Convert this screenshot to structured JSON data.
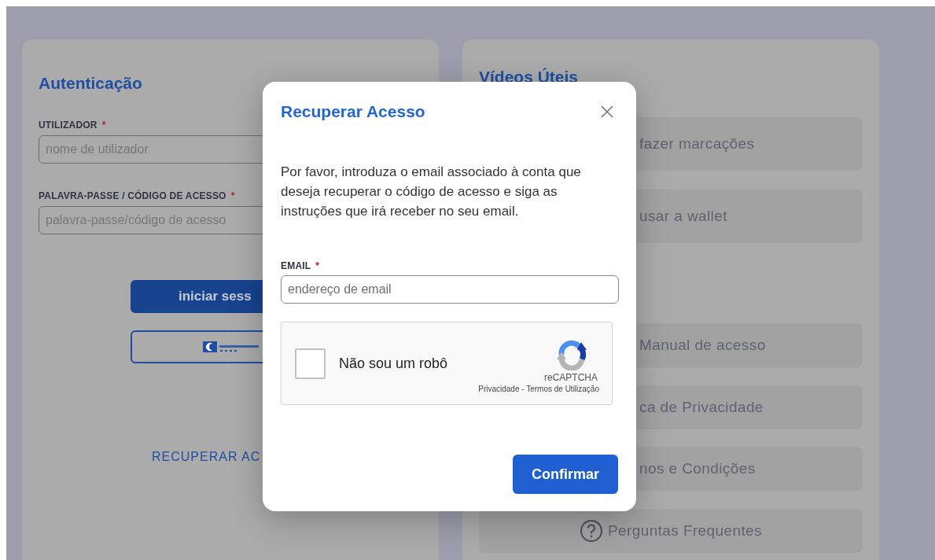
{
  "auth_panel": {
    "title": "Autenticação",
    "fields": [
      {
        "label": "UTILIZADOR",
        "required_mark": "*",
        "placeholder": "nome de utilizador"
      },
      {
        "label": "PALAVRA-PASSE / CÓDIGO DE ACESSO",
        "required_mark": "*",
        "placeholder": "palavra-passe/código de acesso"
      }
    ],
    "login_button": "iniciar sess",
    "recover_link": "RECUPERAR AC"
  },
  "videos_panel": {
    "title": "Vídeos Úteis",
    "items": [
      {
        "kind": "cut",
        "label": "fazer marcações"
      },
      {
        "kind": "cut",
        "label": "usar a wallet"
      },
      {
        "kind": "cut",
        "label": "Manual de acesso"
      },
      {
        "kind": "cut",
        "label": "ca de Privacidade"
      },
      {
        "kind": "cut",
        "label": "nos e Condições"
      },
      {
        "kind": "help",
        "label": "Perguntas Frequentes"
      }
    ]
  },
  "modal": {
    "title": "Recuperar Acesso",
    "text": "Por favor, introduza o email associado à conta que deseja recuperar o código de acesso e siga as instruções que irá receber no seu email.",
    "email_field": {
      "label": "EMAIL",
      "required_mark": "*",
      "placeholder": "endereço de email"
    },
    "captcha": {
      "label": "Não sou um robô",
      "checked": false,
      "brand": "reCAPTCHA",
      "links": "Privacidade - Termos de Utilização"
    },
    "confirm_button": "Confirmar"
  }
}
